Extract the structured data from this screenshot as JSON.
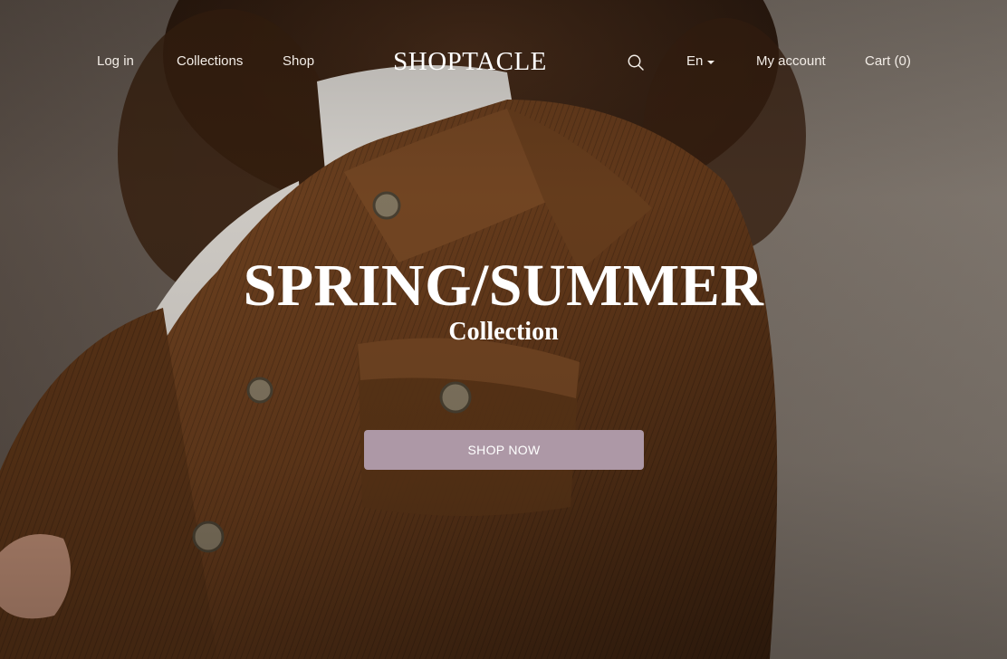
{
  "nav": {
    "login_label": "Log in",
    "collections_label": "Collections",
    "shop_label": "Shop",
    "brand": "SHOPTACLE",
    "search_icon": "search-icon",
    "language_label": "En",
    "account_label": "My account",
    "cart_label": "Cart (0)"
  },
  "hero": {
    "headline": "SPRING/SUMMER",
    "subline": "Collection",
    "cta_label": "SHOP NOW",
    "image_subject": "woman in brown corduroy jacket over white turtleneck"
  },
  "colors": {
    "cta_background": "#ad98a6",
    "text": "#ffffff",
    "jacket": "#6b3f1e",
    "backdrop": "#7b7068"
  }
}
